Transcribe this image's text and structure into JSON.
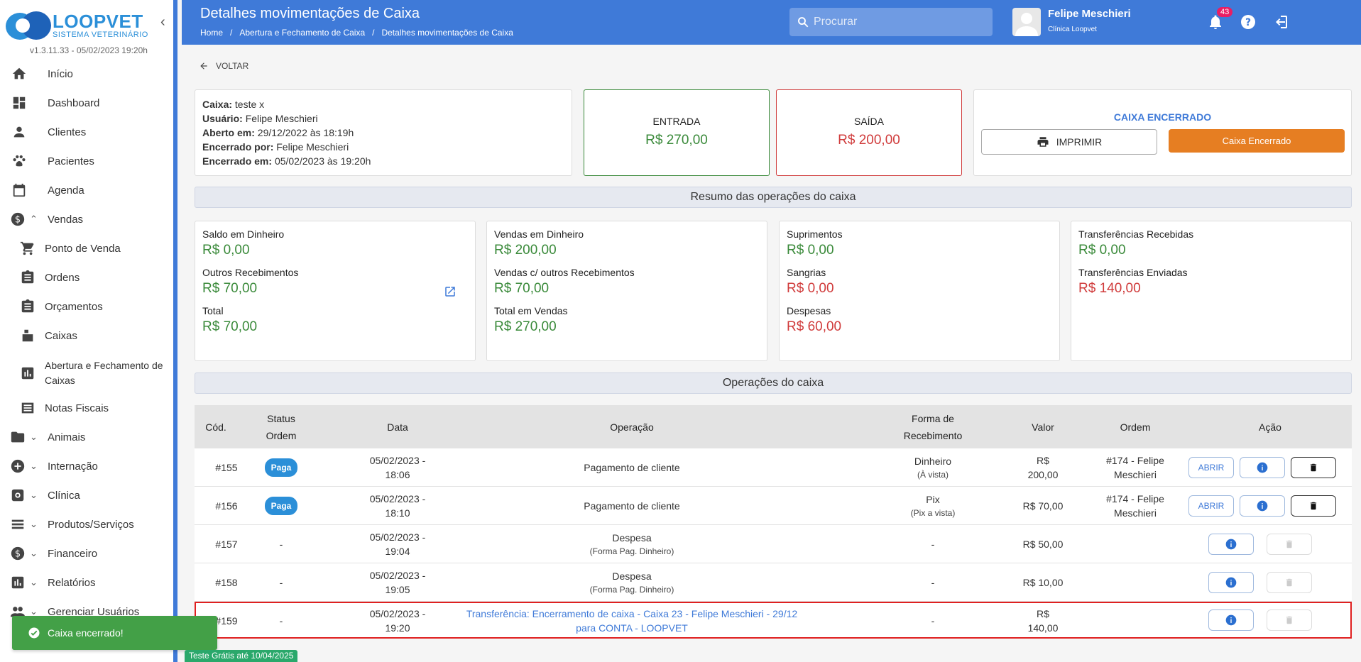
{
  "app": {
    "logo_title": "LOOPVET",
    "logo_sub": "SISTEMA VETERINÁRIO",
    "version": "v1.3.11.33 - 05/02/2023 19:20h"
  },
  "sidebar": {
    "items": [
      {
        "label": "Início",
        "icon": "home-icon"
      },
      {
        "label": "Dashboard",
        "icon": "dashboard-icon"
      },
      {
        "label": "Clientes",
        "icon": "person-icon"
      },
      {
        "label": "Pacientes",
        "icon": "paw-icon"
      },
      {
        "label": "Agenda",
        "icon": "calendar-icon"
      },
      {
        "label": "Vendas",
        "icon": "dollar-icon"
      },
      {
        "label": "Ponto de Venda",
        "icon": "cart-icon"
      },
      {
        "label": "Ordens",
        "icon": "clipboard-icon"
      },
      {
        "label": "Orçamentos",
        "icon": "clipboard-icon"
      },
      {
        "label": "Caixas",
        "icon": "cash-register-icon"
      },
      {
        "label": "Abertura e Fechamento de Caixas",
        "icon": "chart-icon"
      },
      {
        "label": "Notas Fiscais",
        "icon": "list-icon"
      },
      {
        "label": "Animais",
        "icon": "folder-icon"
      },
      {
        "label": "Internação",
        "icon": "medical-icon"
      },
      {
        "label": "Clínica",
        "icon": "gear-icon"
      },
      {
        "label": "Produtos/Serviços",
        "icon": "list-icon"
      },
      {
        "label": "Financeiro",
        "icon": "dollar-icon"
      },
      {
        "label": "Relatórios",
        "icon": "chart-icon"
      },
      {
        "label": "Gerenciar Usuários",
        "icon": "people-icon"
      }
    ]
  },
  "header": {
    "title": "Detalhes movimentações de Caixa",
    "breadcrumb": [
      "Home",
      "Abertura e Fechamento de Caixa",
      "Detalhes movimentações de Caixa"
    ],
    "breadcrumb_sep": "/",
    "search_placeholder": "Procurar",
    "user_name": "Felipe Meschieri",
    "user_clinic": "Clínica Loopvet",
    "notifications": "43"
  },
  "back_label": "VOLTAR",
  "info": {
    "caixa_label": "Caixa:",
    "caixa_value": "teste x",
    "usuario_label": "Usuário:",
    "usuario_value": "Felipe Meschieri",
    "aberto_label": "Aberto em:",
    "aberto_value": "29/12/2022 às 18:19h",
    "encerrado_por_label": "Encerrado por:",
    "encerrado_por_value": "Felipe Meschieri",
    "encerrado_em_label": "Encerrado em:",
    "encerrado_em_value": "05/02/2023 às 19:20h"
  },
  "entrada": {
    "title": "ENTRADA",
    "value": "R$ 270,00"
  },
  "saida": {
    "title": "SAÍDA",
    "value": "R$ 200,00"
  },
  "status": {
    "title": "CAIXA ENCERRADO",
    "print_label": "IMPRIMIR",
    "closed_label": "Caixa Encerrado"
  },
  "resumo": {
    "title": "Resumo das operações do caixa",
    "c1": {
      "l1": "Saldo em Dinheiro",
      "v1": "R$ 0,00",
      "l2": "Outros Recebimentos",
      "v2": "R$ 70,00",
      "l3": "Total",
      "v3": "R$ 70,00"
    },
    "c2": {
      "l1": "Vendas em Dinheiro",
      "v1": "R$ 200,00",
      "l2": "Vendas c/ outros Recebimentos",
      "v2": "R$ 70,00",
      "l3": "Total em Vendas",
      "v3": "R$ 270,00"
    },
    "c3": {
      "l1": "Suprimentos",
      "v1": "R$ 0,00",
      "l2": "Sangrias",
      "v2": "R$ 0,00",
      "l3": "Despesas",
      "v3": "R$ 60,00"
    },
    "c4": {
      "l1": "Transferências Recebidas",
      "v1": "R$ 0,00",
      "l2": "Transferências Enviadas",
      "v2": "R$ 140,00"
    }
  },
  "operacoes": {
    "title": "Operações do caixa",
    "headers": {
      "cod": "Cód.",
      "status_1": "Status",
      "status_2": "Ordem",
      "data": "Data",
      "operacao": "Operação",
      "forma_1": "Forma de",
      "forma_2": "Recebimento",
      "valor": "Valor",
      "ordem": "Ordem",
      "acao": "Ação"
    },
    "abrir_label": "ABRIR",
    "rows": [
      {
        "cod": "#155",
        "status": "Paga",
        "data1": "05/02/2023 -",
        "data2": "18:06",
        "op1": "Pagamento de cliente",
        "op2": "",
        "forma1": "Dinheiro",
        "forma2": "(À vista)",
        "valor1": "R$",
        "valor2": "200,00",
        "ordem1": "#174 - Felipe",
        "ordem2": "Meschieri"
      },
      {
        "cod": "#156",
        "status": "Paga",
        "data1": "05/02/2023 -",
        "data2": "18:10",
        "op1": "Pagamento de cliente",
        "op2": "",
        "forma1": "Pix",
        "forma2": "(Pix a vista)",
        "valor1": "R$ 70,00",
        "valor2": "",
        "ordem1": "#174 - Felipe",
        "ordem2": "Meschieri"
      },
      {
        "cod": "#157",
        "status": "-",
        "data1": "05/02/2023 -",
        "data2": "19:04",
        "op1": "Despesa",
        "op2": "(Forma Pag. Dinheiro)",
        "forma1": "-",
        "forma2": "",
        "valor1": "R$ 50,00",
        "valor2": "",
        "ordem1": "",
        "ordem2": ""
      },
      {
        "cod": "#158",
        "status": "-",
        "data1": "05/02/2023 -",
        "data2": "19:05",
        "op1": "Despesa",
        "op2": "(Forma Pag. Dinheiro)",
        "forma1": "-",
        "forma2": "",
        "valor1": "R$ 10,00",
        "valor2": "",
        "ordem1": "",
        "ordem2": ""
      },
      {
        "cod": "#159",
        "status": "-",
        "data1": "05/02/2023 -",
        "data2": "19:20",
        "op1": "Transferência: Encerramento de caixa - Caixa 23 - Felipe Meschieri - 29/12",
        "op2": "para CONTA - LOOPVET",
        "forma1": "-",
        "forma2": "",
        "valor1": "R$",
        "valor2": "140,00",
        "ordem1": "",
        "ordem2": ""
      }
    ]
  },
  "toast": "Caixa encerrado!",
  "trial": "Teste Grátis até 10/04/2025",
  "colors": {
    "primary": "#3f7ad8",
    "green": "#3a8a3a",
    "red": "#d03b3b",
    "orange": "#e67e22",
    "toast": "#43a047"
  }
}
